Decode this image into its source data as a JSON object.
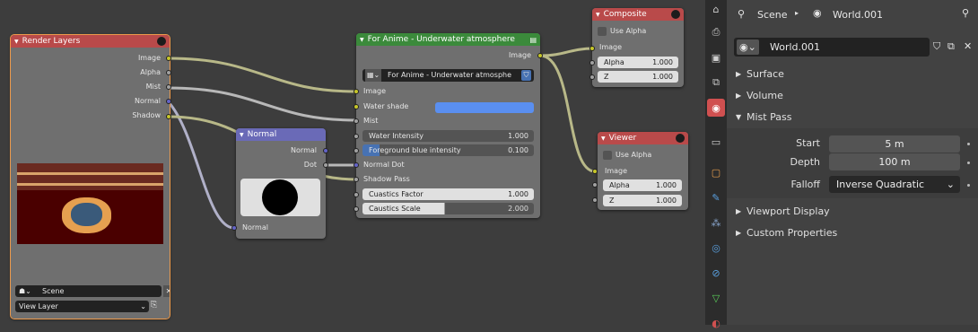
{
  "render_layers": {
    "title": "Render Layers",
    "outputs": [
      "Image",
      "Alpha",
      "Mist",
      "Normal",
      "Shadow"
    ],
    "scene": "Scene",
    "view_layer": "View Layer"
  },
  "normal_node": {
    "title": "Normal",
    "outputs": [
      "Normal",
      "Dot"
    ],
    "input": "Normal"
  },
  "group_node": {
    "title": "For Anime - Underwater atmosphere",
    "output": "Image",
    "group_name": "For Anime - Underwater atmosphe",
    "inputs": [
      "Image",
      "Water shade",
      "Mist"
    ],
    "water_shade_color": "#5a8ff0",
    "fields": [
      {
        "label": "Water Intensity",
        "value": "1.000"
      },
      {
        "label": "Foreground blue intensity",
        "value": "0.100"
      }
    ],
    "extra_inputs": [
      "Normal Dot",
      "Shadow Pass"
    ],
    "fields2": [
      {
        "label": "Cuastics Factor",
        "value": "1.000"
      },
      {
        "label": "Caustics Scale",
        "value": "2.000"
      }
    ]
  },
  "composite": {
    "title": "Composite",
    "use_alpha": "Use Alpha",
    "image": "Image",
    "alpha_label": "Alpha",
    "alpha_value": "1.000",
    "z_label": "Z",
    "z_value": "1.000"
  },
  "viewer": {
    "title": "Viewer",
    "use_alpha": "Use Alpha",
    "image": "Image",
    "alpha_label": "Alpha",
    "alpha_value": "1.000",
    "z_label": "Z",
    "z_value": "1.000"
  },
  "props": {
    "breadcrumb_scene": "Scene",
    "breadcrumb_world": "World.001",
    "world_name": "World.001",
    "panels": [
      "Surface",
      "Volume",
      "Mist Pass",
      "Viewport Display",
      "Custom Properties"
    ],
    "mist": {
      "start_label": "Start",
      "start_value": "5 m",
      "depth_label": "Depth",
      "depth_value": "100 m",
      "falloff_label": "Falloff",
      "falloff_value": "Inverse Quadratic"
    }
  },
  "colors": {
    "render_header": "#b94a4a",
    "normal_header": "#6a6ab7",
    "group_header": "#3b8a3b",
    "output_header": "#b94a4a",
    "selected_outline": "#ed9a4b",
    "world_tab": "#d05050"
  }
}
